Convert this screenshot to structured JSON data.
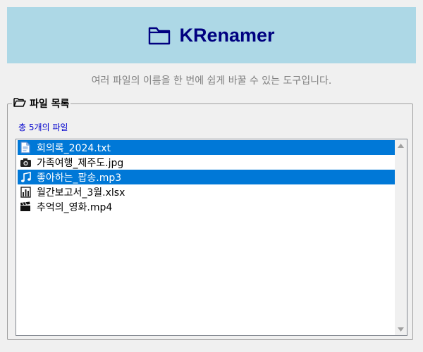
{
  "app": {
    "title": "KRenamer",
    "header_icon": "folder-icon",
    "header_bg": "#add8e6",
    "title_color": "#000080"
  },
  "subtitle": "여러 파일의 이름을 한 번에 쉽게 바꿀 수 있는 도구입니다.",
  "file_group": {
    "label": "파일 목록",
    "icon": "open-folder-icon",
    "count_text": "총 5개의 파일"
  },
  "files": [
    {
      "name": "회의록_2024.txt",
      "icon": "document-icon",
      "selected": true
    },
    {
      "name": "가족여행_제주도.jpg",
      "icon": "camera-icon",
      "selected": false
    },
    {
      "name": "좋아하는_팝송.mp3",
      "icon": "music-note-icon",
      "selected": true
    },
    {
      "name": "월간보고서_3월.xlsx",
      "icon": "bar-chart-icon",
      "selected": false
    },
    {
      "name": "추억의_영화.mp4",
      "icon": "clapperboard-icon",
      "selected": false
    }
  ],
  "colors": {
    "selection": "#0078d7",
    "count_text": "#0000cd"
  }
}
